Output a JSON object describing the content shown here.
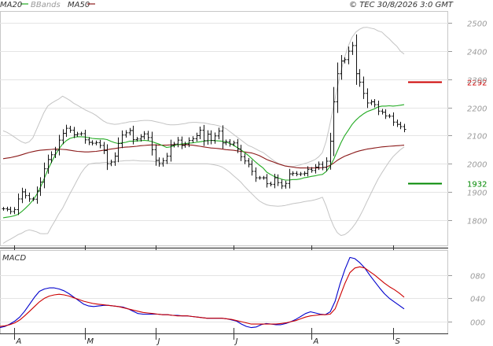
{
  "chart_data": [
    {
      "type": "candlestick",
      "title": "",
      "source": "© TEC 30/8/2026 3:0 GMT",
      "legend": [
        {
          "label": "MA20",
          "color": "#22aa22"
        },
        {
          "label": "BBands",
          "color": "#bbbbbb"
        },
        {
          "label": "MA50",
          "color": "#8b1a1a"
        }
      ],
      "y_ticks": [
        1800,
        1900,
        2000,
        2100,
        2200,
        2300,
        2400,
        2500
      ],
      "ylim": [
        1710,
        2540
      ],
      "x_ticks": [
        "A",
        "M",
        "J",
        "J",
        "A",
        "S"
      ],
      "levels": [
        {
          "label": "2292",
          "value": 2292,
          "color": "#cc0000"
        },
        {
          "label": "1932",
          "value": 1932,
          "color": "#008800"
        }
      ],
      "close": [
        1840,
        1838,
        1830,
        1837,
        1875,
        1900,
        1887,
        1875,
        1874,
        1903,
        1935,
        1982,
        2015,
        2032,
        2048,
        2084,
        2108,
        2126,
        2119,
        2103,
        2106,
        2107,
        2085,
        2076,
        2073,
        2075,
        2065,
        2047,
        2000,
        2006,
        2027,
        2072,
        2102,
        2110,
        2118,
        2086,
        2088,
        2096,
        2106,
        2093,
        2050,
        2012,
        2000,
        2011,
        2027,
        2066,
        2070,
        2084,
        2065,
        2070,
        2083,
        2089,
        2100,
        2119,
        2082,
        2105,
        2083,
        2099,
        2116,
        2074,
        2078,
        2070,
        2074,
        2052,
        2025,
        2010,
        1998,
        1973,
        1950,
        1950,
        1950,
        1929,
        1927,
        1950,
        1933,
        1921,
        1930,
        1964,
        1966,
        1963,
        1964,
        1966,
        1980,
        1976,
        1988,
        1998,
        1987,
        2009,
        2080,
        2220,
        2320,
        2365,
        2370,
        2400,
        2420,
        2320,
        2290,
        2250,
        2216,
        2220,
        2210,
        2187,
        2183,
        2170,
        2169,
        2148,
        2140,
        2132,
        2122
      ],
      "ma20": [
        1808,
        1810,
        1812,
        1815,
        1820,
        1830,
        1842,
        1855,
        1870,
        1890,
        1915,
        1945,
        1978,
        2005,
        2030,
        2052,
        2070,
        2082,
        2090,
        2094,
        2096,
        2096,
        2095,
        2093,
        2090,
        2089,
        2088,
        2088,
        2086,
        2080,
        2075,
        2072,
        2074,
        2076,
        2080,
        2080,
        2081,
        2082,
        2083,
        2082,
        2079,
        2074,
        2070,
        2064,
        2058,
        2060,
        2064,
        2068,
        2070,
        2072,
        2073,
        2074,
        2076,
        2078,
        2080,
        2082,
        2083,
        2082,
        2081,
        2080,
        2078,
        2072,
        2066,
        2058,
        2050,
        2040,
        2030,
        2018,
        2006,
        1995,
        1985,
        1970,
        1962,
        1955,
        1950,
        1945,
        1942,
        1942,
        1944,
        1944,
        1946,
        1950,
        1952,
        1955,
        1957,
        1960,
        1962,
        1972,
        1990,
        2015,
        2045,
        2075,
        2100,
        2120,
        2140,
        2155,
        2167,
        2177,
        2185,
        2190,
        2195,
        2202,
        2205,
        2205,
        2206,
        2205,
        2206,
        2208,
        2210
      ],
      "ma50": [
        2018,
        2020,
        2022,
        2025,
        2028,
        2032,
        2036,
        2040,
        2043,
        2046,
        2048,
        2049,
        2050,
        2051,
        2052,
        2052,
        2051,
        2050,
        2048,
        2046,
        2044,
        2043,
        2042,
        2042,
        2043,
        2044,
        2046,
        2048,
        2050,
        2052,
        2054,
        2056,
        2058,
        2059,
        2060,
        2061,
        2062,
        2064,
        2065,
        2066,
        2067,
        2067,
        2066,
        2066,
        2066,
        2067,
        2068,
        2068,
        2068,
        2068,
        2067,
        2066,
        2064,
        2062,
        2060,
        2058,
        2056,
        2055,
        2054,
        2052,
        2050,
        2049,
        2048,
        2046,
        2044,
        2042,
        2040,
        2038,
        2034,
        2029,
        2022,
        2015,
        2010,
        2005,
        2000,
        1996,
        1992,
        1990,
        1988,
        1986,
        1985,
        1985,
        1985,
        1985,
        1985,
        1985,
        1986,
        1988,
        1994,
        2002,
        2012,
        2020,
        2027,
        2032,
        2037,
        2042,
        2046,
        2049,
        2052,
        2054,
        2056,
        2058,
        2060,
        2061,
        2062,
        2063,
        2064,
        2065,
        2066
      ],
      "bb_upper": [
        2117,
        2112,
        2104,
        2095,
        2086,
        2078,
        2073,
        2078,
        2092,
        2122,
        2152,
        2182,
        2205,
        2215,
        2223,
        2230,
        2240,
        2233,
        2225,
        2215,
        2208,
        2200,
        2192,
        2186,
        2180,
        2172,
        2162,
        2152,
        2145,
        2142,
        2140,
        2141,
        2144,
        2146,
        2149,
        2150,
        2151,
        2153,
        2154,
        2154,
        2153,
        2150,
        2147,
        2144,
        2140,
        2138,
        2138,
        2139,
        2141,
        2143,
        2146,
        2147,
        2147,
        2146,
        2145,
        2143,
        2140,
        2138,
        2135,
        2130,
        2125,
        2115,
        2105,
        2095,
        2085,
        2075,
        2065,
        2060,
        2053,
        2046,
        2040,
        2030,
        2020,
        2010,
        2002,
        1996,
        1991,
        1990,
        1990,
        1993,
        1996,
        2000,
        2004,
        2009,
        2015,
        2025,
        2040,
        2080,
        2140,
        2205,
        2270,
        2330,
        2380,
        2420,
        2450,
        2468,
        2478,
        2484,
        2485,
        2482,
        2479,
        2472,
        2468,
        2455,
        2444,
        2430,
        2418,
        2400,
        2390
      ],
      "bb_lower": [
        1717,
        1725,
        1732,
        1740,
        1748,
        1753,
        1761,
        1765,
        1762,
        1758,
        1752,
        1751,
        1752,
        1776,
        1798,
        1822,
        1842,
        1868,
        1894,
        1918,
        1943,
        1967,
        1985,
        1998,
        2001,
        2003,
        2003,
        2004,
        2005,
        2007,
        2008,
        2009,
        2010,
        2011,
        2011,
        2012,
        2011,
        2010,
        2010,
        2010,
        2009,
        2008,
        2006,
        2004,
        2002,
        2001,
        2000,
        2000,
        2000,
        2000,
        2000,
        2000,
        2000,
        2000,
        2000,
        2000,
        1998,
        1996,
        1993,
        1988,
        1980,
        1970,
        1958,
        1947,
        1935,
        1920,
        1906,
        1893,
        1880,
        1868,
        1860,
        1854,
        1851,
        1850,
        1849,
        1850,
        1852,
        1855,
        1858,
        1860,
        1862,
        1865,
        1867,
        1869,
        1872,
        1876,
        1881,
        1850,
        1810,
        1778,
        1755,
        1745,
        1748,
        1758,
        1772,
        1790,
        1812,
        1838,
        1866,
        1893,
        1920,
        1946,
        1968,
        1988,
        2008,
        2025,
        2038,
        2050,
        2060
      ]
    },
    {
      "type": "line",
      "title": "MACD",
      "y_ticks": [
        "080",
        "040",
        "000"
      ],
      "ylim": [
        -20,
        120
      ],
      "series": [
        {
          "name": "",
          "color": "#0000cc",
          "values": [
            -10,
            -8,
            -4,
            1,
            8,
            18,
            30,
            42,
            52,
            56,
            58,
            58,
            56,
            53,
            48,
            42,
            36,
            30,
            27,
            26,
            27,
            28,
            28,
            27,
            26,
            25,
            22,
            18,
            14,
            13,
            13,
            13,
            13,
            12,
            12,
            11,
            11,
            10,
            10,
            9,
            8,
            7,
            6,
            6,
            6,
            6,
            5,
            3,
            1,
            -4,
            -8,
            -10,
            -9,
            -5,
            -3,
            -4,
            -5,
            -5,
            -3,
            0,
            4,
            9,
            14,
            17,
            15,
            13,
            12,
            17,
            35,
            65,
            90,
            110,
            108,
            101,
            92,
            80,
            69,
            58,
            48,
            40,
            34,
            28,
            22
          ]
        },
        {
          "name": "",
          "color": "#cc0000",
          "values": [
            -8,
            -7,
            -5,
            -2,
            3,
            10,
            18,
            26,
            34,
            40,
            44,
            46,
            47,
            46,
            44,
            41,
            38,
            35,
            33,
            31,
            30,
            29,
            28,
            27,
            26,
            24,
            22,
            20,
            18,
            16,
            15,
            14,
            13,
            12,
            12,
            11,
            10,
            10,
            10,
            9,
            8,
            7,
            6,
            6,
            6,
            6,
            5,
            4,
            2,
            0,
            -2,
            -4,
            -4,
            -4,
            -4,
            -4,
            -4,
            -3,
            -2,
            0,
            2,
            5,
            8,
            10,
            11,
            12,
            12,
            13,
            22,
            44,
            66,
            84,
            92,
            94,
            92,
            86,
            80,
            73,
            66,
            60,
            55,
            49,
            42
          ]
        }
      ]
    }
  ]
}
